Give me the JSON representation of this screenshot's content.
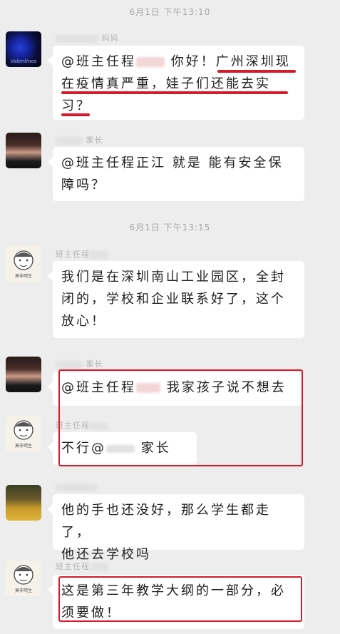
{
  "timestamps": [
    "6月1日 下午13:10",
    "6月1日 下午13:15"
  ],
  "messages": [
    {
      "sender": "妈妈",
      "lines": [
        "@班主任程",
        "你好！广州深圳现",
        "在疫情真严重，娃子们还能去实",
        "习？"
      ],
      "prefix": "@班主任程",
      "gap_line1": "你好！广州深圳现"
    },
    {
      "sender": "家长",
      "lines": [
        "@班主任程正江  就是  能有安全保",
        "障吗？"
      ]
    },
    {
      "sender": "班主任程",
      "lines": [
        "我们是在深圳南山工业园区，全封",
        "闭的，学校和企业联系好了，这个",
        "放心！"
      ]
    },
    {
      "sender": "家长",
      "lines": [
        "@班主任程",
        "我家孩子说不想去"
      ]
    },
    {
      "sender": "班主任程",
      "lines": [
        "不行@",
        "家长"
      ]
    },
    {
      "sender": "",
      "lines": [
        "他的手也还没好，那么学生都走了，",
        "他还去学校吗"
      ]
    },
    {
      "sender": "班主任程",
      "lines": [
        "这是第三年教学大纲的一部分，必",
        "须要做！"
      ]
    }
  ],
  "avatars": {
    "rose_caption": "Valentines",
    "cartoon_caption": "莫非晴生"
  },
  "colors": {
    "highlight": "#d7192a",
    "background": "#ededed",
    "bubble": "#ffffff"
  }
}
